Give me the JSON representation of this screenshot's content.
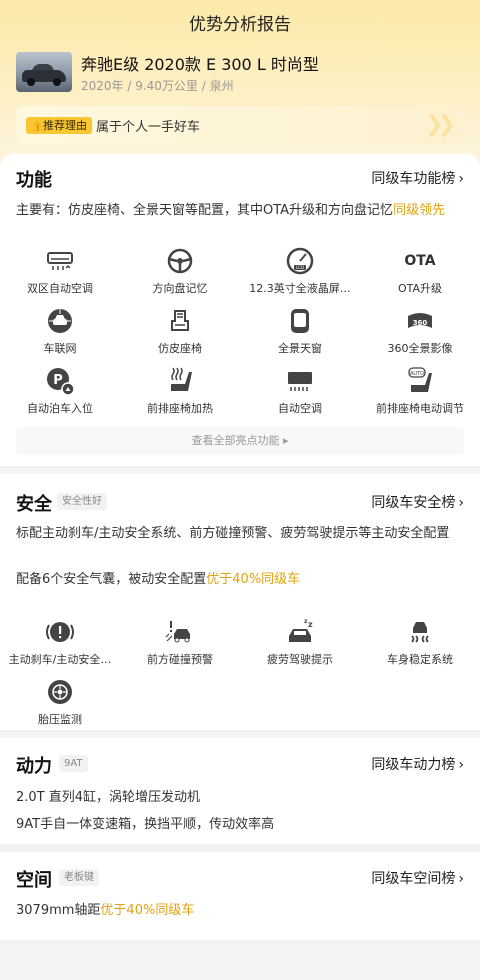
{
  "header": {
    "title": "优势分析报告"
  },
  "car": {
    "name": "奔驰E级 2020款 E 300 L 时尚型",
    "meta": "2020年 / 9.40万公里 / 泉州"
  },
  "reason": {
    "tag": "推荐理由",
    "text": "属于个人一手好车"
  },
  "sections": {
    "function": {
      "title": "功能",
      "link": "同级车功能榜",
      "summary_prefix": "主要有：仿皮座椅、全景天窗等配置，其中OTA升级和方向盘记忆",
      "summary_highlight": "同级领先",
      "items": [
        {
          "label": "双区自动空调",
          "icon": "dual-zone-ac-icon"
        },
        {
          "label": "方向盘记忆",
          "icon": "steering-wheel-memory-icon"
        },
        {
          "label": "12.3英寸全液晶屏…",
          "icon": "lcd-dashboard-icon"
        },
        {
          "label": "OTA升级",
          "icon": "ota-icon",
          "icon_text": "OTA"
        },
        {
          "label": "车联网",
          "icon": "connected-car-icon"
        },
        {
          "label": "仿皮座椅",
          "icon": "leather-seat-icon"
        },
        {
          "label": "全景天窗",
          "icon": "panoramic-sunroof-icon"
        },
        {
          "label": "360全景影像",
          "icon": "360-camera-icon"
        },
        {
          "label": "自动泊车入位",
          "icon": "auto-parking-icon"
        },
        {
          "label": "前排座椅加热",
          "icon": "seat-heating-icon"
        },
        {
          "label": "自动空调",
          "icon": "auto-ac-icon"
        },
        {
          "label": "前排座椅电动调节",
          "icon": "power-seat-icon"
        }
      ],
      "view_all": "查看全部亮点功能"
    },
    "safety": {
      "title": "安全",
      "badge": "安全性好",
      "link": "同级车安全榜",
      "line1": "标配主动刹车/主动安全系统、前方碰撞预警、疲劳驾驶提示等主动安全配置",
      "line2_prefix": "配备6个安全气囊，被动安全配置",
      "line2_highlight": "优于40%同级车",
      "items": [
        {
          "label": "主动刹车/主动安全…",
          "icon": "active-brake-icon"
        },
        {
          "label": "前方碰撞预警",
          "icon": "collision-warning-icon"
        },
        {
          "label": "疲劳驾驶提示",
          "icon": "fatigue-alert-icon"
        },
        {
          "label": "车身稳定系统",
          "icon": "stability-control-icon"
        },
        {
          "label": "胎压监测",
          "icon": "tire-pressure-icon"
        }
      ]
    },
    "power": {
      "title": "动力",
      "badge": "9AT",
      "link": "同级车动力榜",
      "line1": "2.0T 直列4缸，涡轮增压发动机",
      "line2": "9AT手自一体变速箱，换挡平顺，传动效率高"
    },
    "space": {
      "title": "空间",
      "badge": "老板键",
      "link": "同级车空间榜",
      "line_prefix": "3079mm轴距",
      "line_highlight": "优于40%同级车"
    }
  },
  "colors": {
    "accent": "#e0a30f",
    "tag": "#f9c634"
  }
}
